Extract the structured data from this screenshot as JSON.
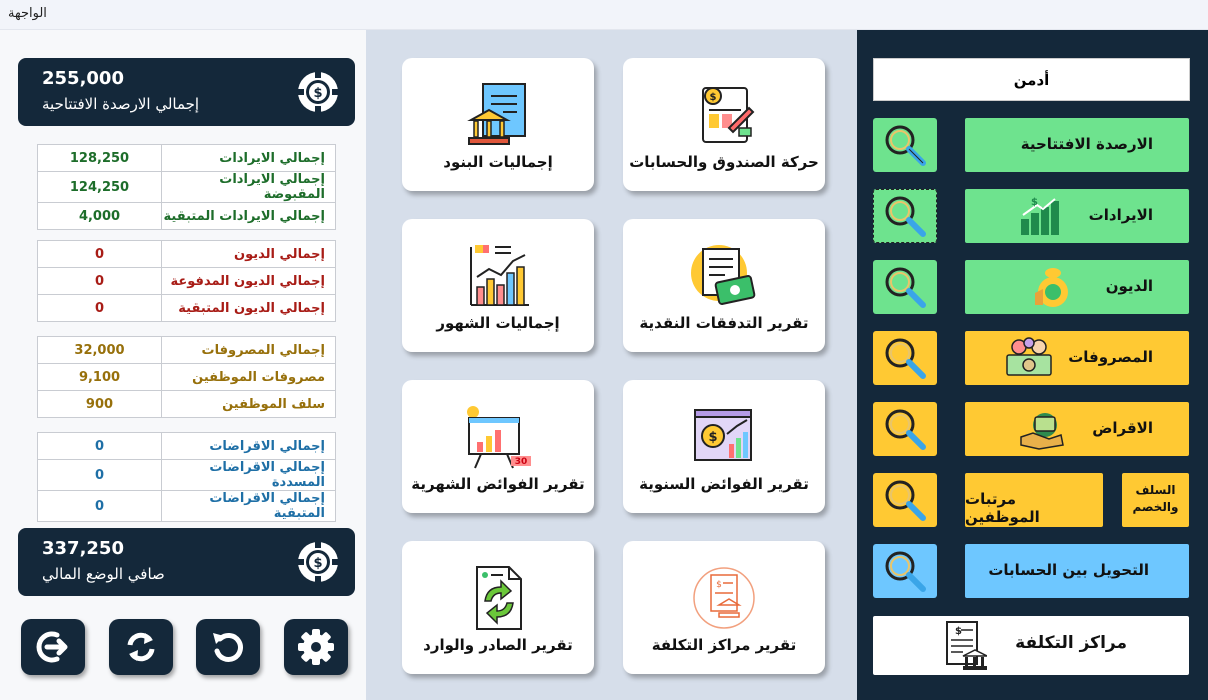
{
  "window": {
    "title": "الواجهة"
  },
  "summary": {
    "opening": {
      "value": "255,000",
      "label": "إجمالي الارصدة الافتتاحية"
    },
    "net": {
      "value": "337,250",
      "label": "صافي الوضع المالي"
    }
  },
  "groups": [
    {
      "rows": [
        {
          "label": "إجمالي الايرادات",
          "value": "128,250"
        },
        {
          "label": "إجمالي الايرادات المقبوضة",
          "value": "124,250"
        },
        {
          "label": "إجمالي الايرادات المتبقية",
          "value": "4,000"
        }
      ],
      "color": "#1d6d2a"
    },
    {
      "rows": [
        {
          "label": "إجمالي الديون",
          "value": "0"
        },
        {
          "label": "إجمالي الديون المدفوعة",
          "value": "0"
        },
        {
          "label": "إجمالي الديون المتبقية",
          "value": "0"
        }
      ],
      "color": "#a81c16"
    },
    {
      "rows": [
        {
          "label": "إجمالي المصروفات",
          "value": "32,000"
        },
        {
          "label": "مصروفات الموظفين",
          "value": "9,100"
        },
        {
          "label": "سلف الموظفين",
          "value": "900"
        }
      ],
      "color": "#97700b"
    },
    {
      "rows": [
        {
          "label": "إجمالي الاقراضات",
          "value": "0"
        },
        {
          "label": "إجمالي الاقراضات المسددة",
          "value": "0"
        },
        {
          "label": "إجمالي الاقراضات المتبقية",
          "value": "0"
        }
      ],
      "color": "#1e6fa6"
    }
  ],
  "reports": {
    "r1": "حركة الصندوق والحسابات",
    "r2": "إجماليات البنود",
    "r3": "تقرير التدفقات النقدية",
    "r4": "إجماليات الشهور",
    "r5": "تقرير الفوائض السنوية",
    "r6": "تقرير الفوائض الشهرية",
    "r7": "تقرير مراكز التكلفة",
    "r8": "تقرير الصادر والوارد"
  },
  "sidebar": {
    "user": "أدمن",
    "opening": "الارصدة الافتتاحية",
    "revenues": "الايرادات",
    "debts": "الديون",
    "expenses": "المصروفات",
    "loans": "الاقراض",
    "salaries": "مرتبات الموظفين",
    "advances": "السلف والخصم",
    "transfer": "التحويل بين الحسابات",
    "cost_centers": "مراكز التكلفة"
  },
  "colors": {
    "navy": "#14283a",
    "green": "#6ee38e",
    "yellow": "#ffc933",
    "blue": "#6ec7ff",
    "panel": "#d6deea"
  },
  "icons": {
    "coin": "coin-icon",
    "search": "magnifier-icon",
    "exit": "exit-icon",
    "sync": "sync-icon",
    "refresh": "refresh-icon",
    "settings": "gear-icon"
  }
}
